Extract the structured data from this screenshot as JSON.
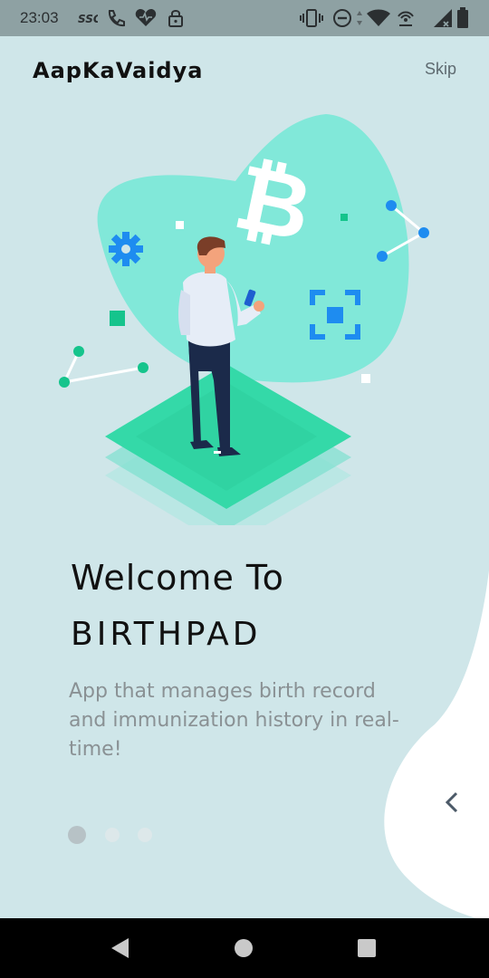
{
  "status_bar": {
    "time": "23:03",
    "left_icons": [
      "ssg-icon",
      "call-icon",
      "heart-icon",
      "lock-icon"
    ],
    "right_icons": [
      "vibrate-icon",
      "dnd-icon",
      "data-arrows-icon",
      "wifi-icon",
      "hotspot-icon",
      "signal-icon",
      "battery-icon"
    ]
  },
  "header": {
    "app_name": "AapKaVaidya",
    "skip_label": "Skip"
  },
  "welcome": {
    "line1": "Welcome To",
    "line2": "BIRTHPAD",
    "description": "App that manages birth record and immunization history in real-time!"
  },
  "pagination": {
    "page_count": 3,
    "active_page": 1,
    "active_color": "#b7c2c6",
    "inactive_color": "#dde8ea"
  },
  "colors": {
    "background": "#cfe6e9",
    "accent_teal": "#34d9a8",
    "accent_blue": "#1e8cf0",
    "status_bar": "#8ea1a3"
  },
  "nav_bar": {
    "buttons": [
      "back-triangle-icon",
      "home-circle-icon",
      "recents-square-icon"
    ]
  }
}
